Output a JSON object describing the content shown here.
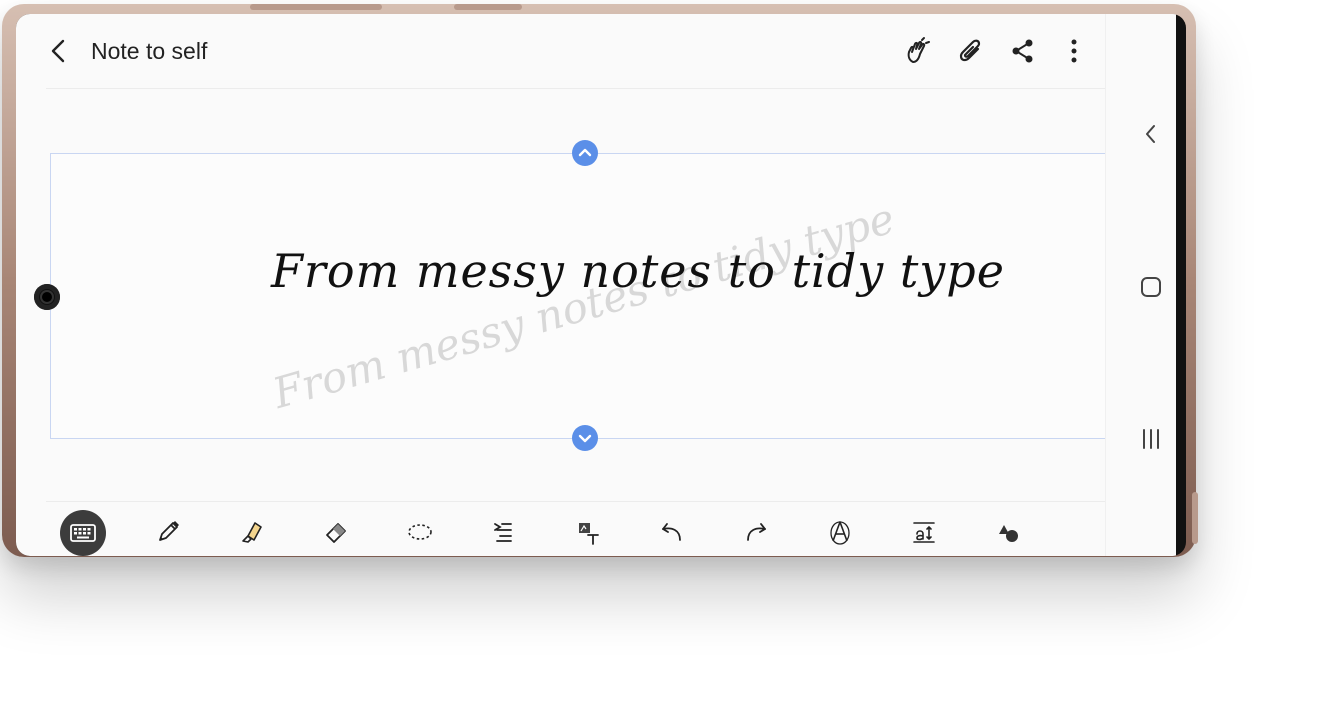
{
  "header": {
    "title": "Note to self"
  },
  "canvas": {
    "text": "From messy notes to tidy type",
    "ghost_text": "From messy notes to tidy type"
  },
  "icons": {
    "back": "back-arrow-icon",
    "header": [
      "touch-hand-icon",
      "attach-icon",
      "share-icon",
      "more-icon"
    ],
    "toolbar": [
      "keyboard-icon",
      "pen-icon",
      "highlighter-icon",
      "eraser-icon",
      "lasso-icon",
      "text-align-icon",
      "insert-text-icon",
      "undo-icon",
      "redo-icon",
      "text-style-icon",
      "text-size-icon",
      "shapes-icon"
    ],
    "nav": [
      "nav-back-icon",
      "nav-home-icon",
      "nav-recents-icon"
    ]
  },
  "colors": {
    "accent": "#5b8fe8",
    "selection_border": "#c9d6f2",
    "phone": "#a88676"
  }
}
